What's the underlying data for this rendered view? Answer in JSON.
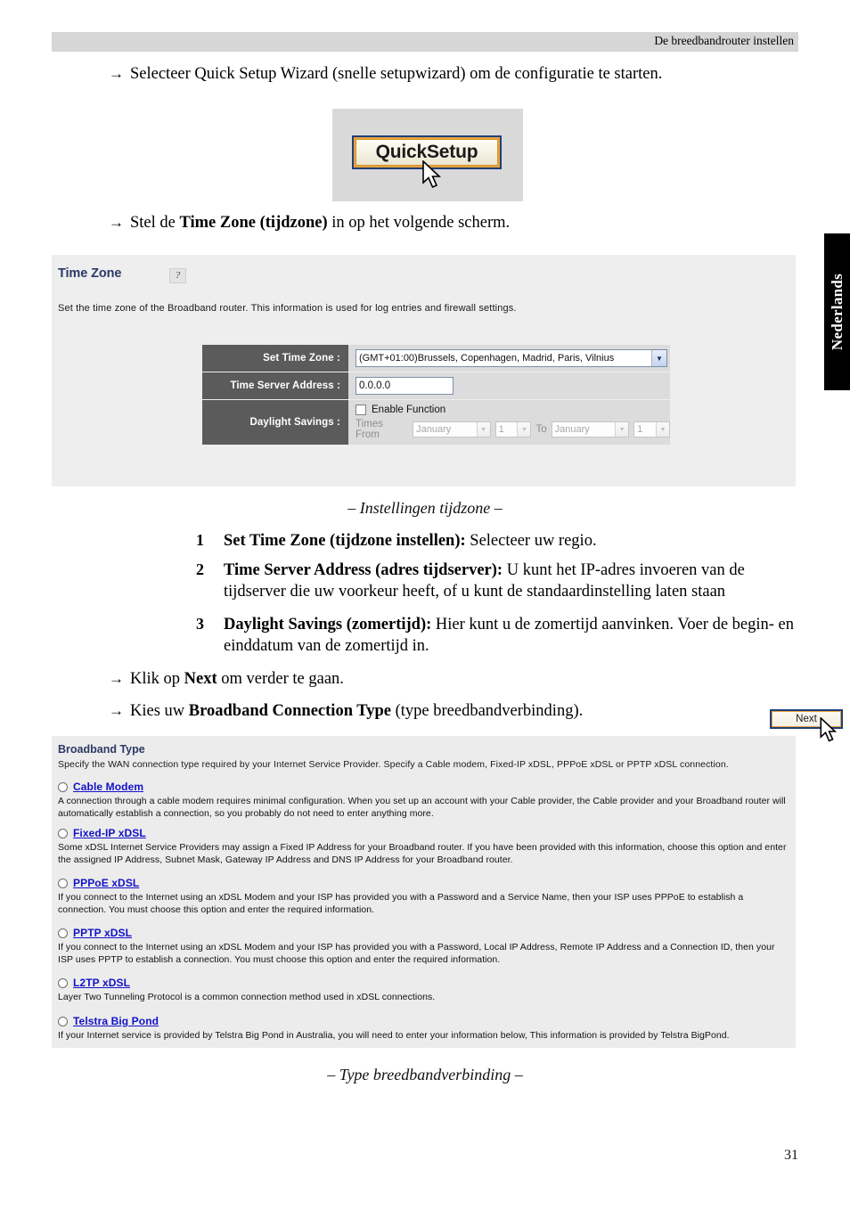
{
  "header": {
    "running_title": "De breedbandrouter instellen"
  },
  "side_tab": {
    "label": "Nederlands"
  },
  "body": {
    "bullet_1_pre": "Selecteer Quick Setup Wizard (snelle setupwizard) om de configuratie te starten.",
    "bullet_2_pre": "Stel de ",
    "bullet_2_bold": "Time Zone (tijdzone)",
    "bullet_2_post": " in op het volgende scherm.",
    "bullet_3_pre": "Klik op ",
    "bullet_3_bold": "Next",
    "bullet_3_post": " om verder te gaan.",
    "bullet_4_pre": "Kies uw ",
    "bullet_4_bold": "Broadband Connection Type",
    "bullet_4_post": " (type breedbandverbinding).",
    "arrow_glyph": "→"
  },
  "quicksetup_figure": {
    "button_label": "QuickSetup",
    "cursor": "mouse-pointer"
  },
  "time_zone_panel": {
    "title": "Time Zone",
    "help_icon": "?",
    "description": "Set the time zone of the Broadband router. This information is used for log entries and firewall settings.",
    "rows": [
      {
        "label": "Set Time Zone :",
        "type": "select",
        "value": "(GMT+01:00)Brussels, Copenhagen, Madrid, Paris, Vilnius"
      },
      {
        "label": "Time Server Address :",
        "type": "text",
        "value": "0.0.0.0"
      },
      {
        "label": "Daylight Savings :",
        "type": "daylight"
      }
    ],
    "daylight": {
      "checkbox_label": "Enable Function",
      "checked": false,
      "times_from_label": "Times From",
      "from_month": "January",
      "from_day": "1",
      "to_label": "To",
      "to_month": "January",
      "to_day": "1"
    },
    "next_button": "Next"
  },
  "caption_1": "– Instellingen tijdzone –",
  "caption_2": "– Type breedbandverbinding –",
  "numbered_list": [
    {
      "number": "1",
      "bold": "Set Time Zone (tijdzone instellen):",
      "rest": " Selecteer uw regio."
    },
    {
      "number": "2",
      "bold": "Time Server Address (adres tijdserver):",
      "rest": " U kunt het IP-adres invoeren van de tijdserver die uw voorkeur heeft, of u kunt de standaardinstelling laten staan"
    },
    {
      "number": "3",
      "bold": "Daylight Savings (zomertijd):",
      "rest": " Hier kunt u de zomertijd aanvinken. Voer de begin- en einddatum van de zomertijd in."
    }
  ],
  "broadband_panel": {
    "title": "Broadband Type",
    "subtitle": "Specify the WAN connection type required by your Internet Service Provider. Specify a Cable modem, Fixed-IP xDSL, PPPoE xDSL or PPTP xDSL connection.",
    "options": [
      {
        "name": "Cable Modem",
        "selected": false,
        "description": "A connection through a cable modem requires minimal configuration. When you set up an account with your Cable provider, the Cable provider and your Broadband router will automatically establish a connection, so you probably do not need to enter anything more."
      },
      {
        "name": "Fixed-IP xDSL",
        "selected": false,
        "description": "Some xDSL Internet Service Providers may assign a Fixed IP Address for your Broadband router. If you have been provided with this information, choose this option and enter the assigned IP Address, Subnet Mask, Gateway IP Address and DNS IP Address for your Broadband router."
      },
      {
        "name": "PPPoE xDSL",
        "selected": false,
        "description": "If you connect to the Internet using an xDSL Modem and your ISP has provided you with a Password and a Service Name, then your ISP uses PPPoE to establish a connection. You must choose this option and enter the required information."
      },
      {
        "name": "PPTP xDSL",
        "selected": false,
        "description": "If you connect to the Internet using an xDSL Modem and your ISP has provided you with a Password, Local IP Address, Remote IP Address and a Connection ID, then your ISP uses PPTP to establish a connection. You must choose this option and enter the required information."
      },
      {
        "name": "L2TP xDSL",
        "selected": false,
        "description": "Layer Two Tunneling Protocol is a common connection method used in xDSL connections."
      },
      {
        "name": "Telstra Big Pond",
        "selected": false,
        "description": "If your Internet service is provided by Telstra Big Pond in Australia, you will need to enter your information below, This information is provided by Telstra BigPond."
      }
    ]
  },
  "page_number": "31",
  "colors": {
    "header_bar": "#d6d6d6",
    "panel_bg": "#eeeeee",
    "label_cell": "#5b5b5b",
    "field_cell": "#dcdcdc",
    "title_blue": "#2b3a66",
    "link_blue": "#1212c8",
    "button_border": "#1f3f7a",
    "button_accent": "#e8a33d"
  }
}
